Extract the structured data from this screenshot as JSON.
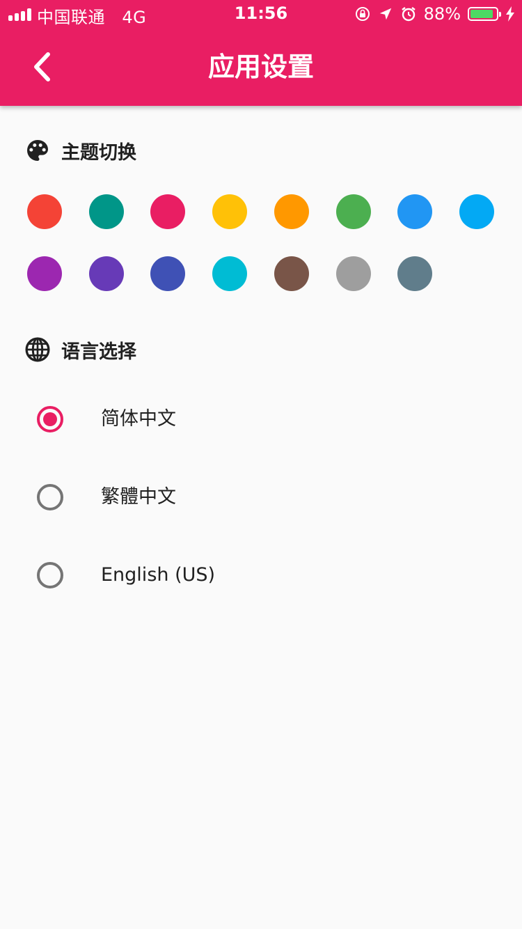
{
  "status_bar": {
    "carrier": "中国联通",
    "network": "4G",
    "time": "11:56",
    "battery_percent": "88%",
    "battery_level": 0.88,
    "battery_color": "#4cd964",
    "icons": [
      "signal-icon",
      "rotation-lock-icon",
      "location-icon",
      "alarm-icon",
      "battery-icon",
      "charging-icon"
    ]
  },
  "header": {
    "title": "应用设置",
    "back_icon": "back-chevron-icon",
    "background": "#e91e63"
  },
  "theme_section": {
    "label": "主题切换",
    "icon": "palette-icon",
    "colors": [
      "#f44336",
      "#009688",
      "#e91e63",
      "#ffc107",
      "#ff9800",
      "#4caf50",
      "#2196f3",
      "#03a9f4",
      "#9c27b0",
      "#673ab7",
      "#3f51b5",
      "#00bcd4",
      "#795548",
      "#9e9e9e",
      "#607d8b"
    ]
  },
  "language_section": {
    "label": "语言选择",
    "icon": "globe-icon",
    "options": [
      {
        "label": "简体中文",
        "selected": true
      },
      {
        "label": "繁體中文",
        "selected": false
      },
      {
        "label": "English (US)",
        "selected": false
      }
    ]
  }
}
